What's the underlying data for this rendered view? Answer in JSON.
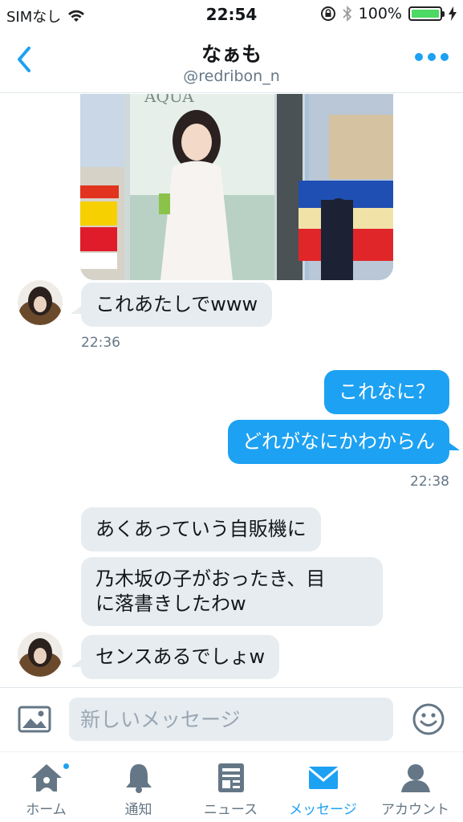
{
  "status_bar": {
    "carrier": "SIMなし",
    "time": "22:54",
    "battery": "100%",
    "battery_level": 1.0,
    "icons": [
      "wifi-icon",
      "rotation-lock-icon",
      "bluetooth-icon",
      "battery-icon",
      "charging-icon"
    ]
  },
  "header": {
    "title": "なぁも",
    "handle": "@redribon_n"
  },
  "messages": {
    "m1": "これあたしでwww",
    "ts1": "22:36",
    "m2": "これなに？",
    "m3": "どれがなにかわからん",
    "ts2": "22:38",
    "m4": "あくあっていう自販機に",
    "m5_line1": "乃木坂の子がおったき、目",
    "m5_line2": "に落書きしたわw",
    "m6": "センスあるでしょw"
  },
  "photo": {
    "sign_text": "AQUA"
  },
  "composer": {
    "placeholder": "新しいメッセージ"
  },
  "tabs": {
    "home": "ホーム",
    "notifications": "通知",
    "news": "ニュース",
    "messages": "メッセージ",
    "account": "アカウント"
  },
  "colors": {
    "accent": "#1da1f2",
    "incoming_bubble": "#e6ecf0",
    "secondary_text": "#657786"
  }
}
